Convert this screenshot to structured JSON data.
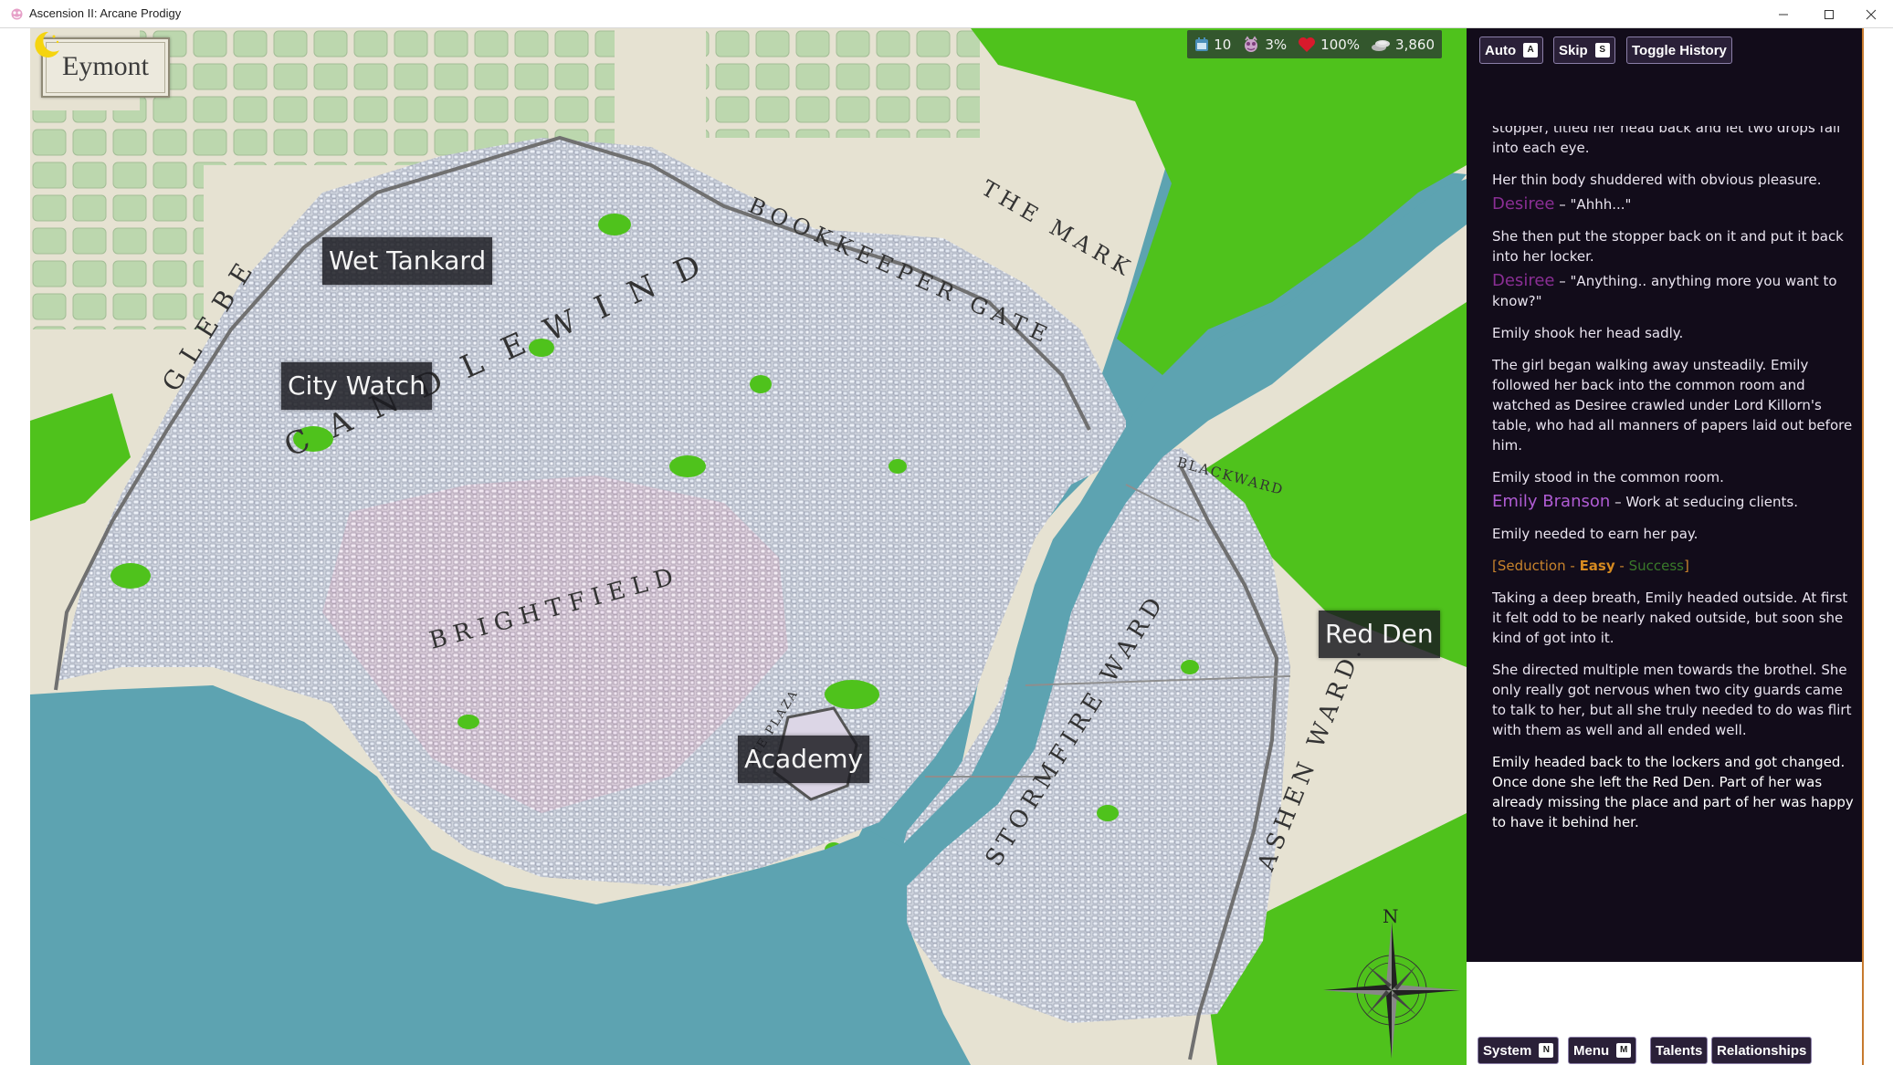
{
  "window": {
    "title": "Ascension II: Arcane Prodigy",
    "controls": [
      "minimize",
      "maximize",
      "close"
    ]
  },
  "map": {
    "city_name": "Eymont",
    "district_labels": [
      "GLEBE",
      "CANDLEWIND",
      "BOOKKEEPER GATE",
      "THE MARK",
      "BRIGHTFIELD",
      "BLACKWARD",
      "STORMFIRE WARD",
      "ASHEN WARD",
      "THE PLAZA"
    ],
    "locations": [
      {
        "name": "Wet Tankard"
      },
      {
        "name": "City Watch"
      },
      {
        "name": "Academy"
      },
      {
        "name": "Red Den"
      }
    ],
    "compass_label": "N",
    "colors": {
      "water": "#5da3b1",
      "land": "#e6e2d2",
      "forest": "#4fc21c",
      "city": "#c3c8d4"
    }
  },
  "hud": {
    "time_icon": "moon-icon",
    "stats": [
      {
        "icon": "calendar-icon",
        "value": "10"
      },
      {
        "icon": "corruption-icon",
        "value": "3%"
      },
      {
        "icon": "heart-icon",
        "value": "100%"
      },
      {
        "icon": "coins-icon",
        "value": "3,860"
      }
    ]
  },
  "panel": {
    "top_buttons": [
      {
        "label": "Auto",
        "key": "A"
      },
      {
        "label": "Skip",
        "key": "S"
      },
      {
        "label": "Toggle History"
      }
    ],
    "bottom_buttons": [
      {
        "label": "System",
        "key": "N"
      },
      {
        "label": "Menu",
        "key": "M"
      },
      {
        "label": "Talents"
      },
      {
        "label": "Relationships"
      }
    ],
    "story": {
      "p1": "stopper, titled her head back and let two drops fall into each eye.",
      "p2": "Her thin body shuddered with obvious pleasure.",
      "d1_speaker": "Desiree",
      "d1_text": "\"Ahhh...\"",
      "p3": "She then put the stopper back on it and put it back into her locker.",
      "d2_speaker": "Desiree",
      "d2_text": "\"Anything.. anything more you want to know?\"",
      "p4": "Emily shook her head sadly.",
      "p5": "The girl began walking away unsteadily. Emily followed her back into the common room and watched as Desiree crawled under Lord Killorn's table, who had all manners of papers laid out before him.",
      "p6": "Emily stood in the common room.",
      "d3_speaker": "Emily Branson",
      "d3_text": "Work at seducing clients.",
      "p7": "Emily needed to earn her pay.",
      "check_open": "[Seduction - ",
      "check_difficulty": "Easy",
      "check_sep": " - ",
      "check_result": "Success",
      "check_close": "]",
      "p8": "Taking a deep breath, Emily headed outside. At first it felt odd to be nearly naked outside, but soon she kind of got into it.",
      "p9": "She directed multiple men towards the brothel. She only really got nervous when two city guards came to talk to her, but all she truly needed to do was flirt with them as well and all ended well.",
      "p10": "Emily headed back to the lockers and got changed. Once done she left the Red Den. Part of her was already missing the place and part of her was happy to have it behind her."
    }
  }
}
